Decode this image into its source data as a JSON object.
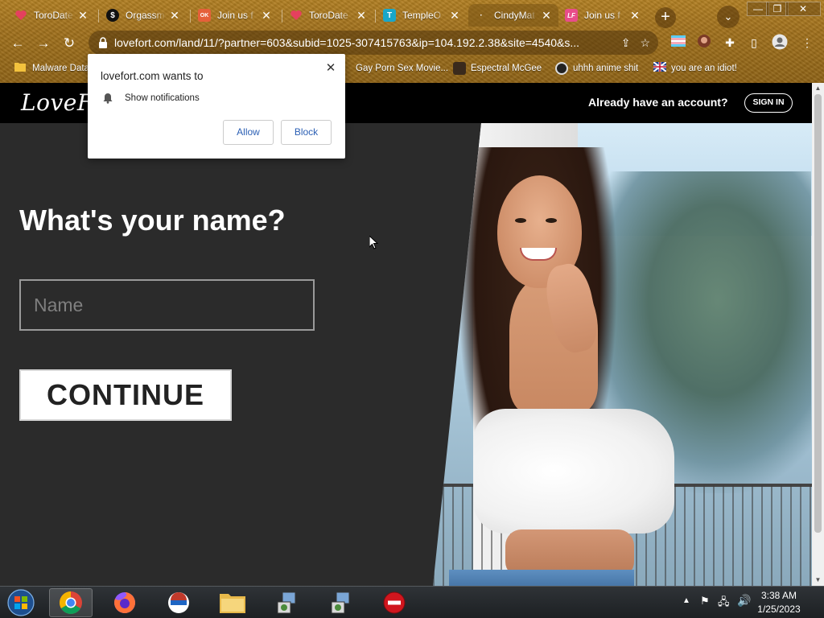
{
  "browser": {
    "tabs": [
      {
        "title": "ToroDate",
        "favicon": "heart-icon"
      },
      {
        "title": "Orgassmo",
        "favicon": "circle-s-icon"
      },
      {
        "title": "Join us f",
        "favicon": "ok-icon",
        "favicon_text": "OK"
      },
      {
        "title": "ToroDate",
        "favicon": "heart-icon"
      },
      {
        "title": "TempleO",
        "favicon": "temple-icon"
      },
      {
        "title": "CindyMat",
        "favicon": "dot-icon"
      },
      {
        "title": "Join us f",
        "favicon": "lf-icon",
        "favicon_text": "LF"
      }
    ],
    "url": "lovefort.com/land/11/?partner=603&subid=1025-307415763&ip=104.192.2.38&site=4540&s...",
    "bookmarks": [
      {
        "label": "Malware Data",
        "icon": "folder-icon"
      },
      {
        "label": "Gay Porn Sex Movie...",
        "icon": "film-icon"
      },
      {
        "label": "Espectral McGee",
        "icon": "ghost-icon"
      },
      {
        "label": "uhhh anime shit",
        "icon": "anime-icon"
      },
      {
        "label": "you are an idiot!",
        "icon": "flag-icon"
      }
    ]
  },
  "notification": {
    "title": "lovefort.com wants to",
    "permission": "Show notifications",
    "allow_label": "Allow",
    "block_label": "Block",
    "close_icon": "close-icon"
  },
  "site": {
    "logo": "LoveFort",
    "already_account": "Already have an account?",
    "signin_label": "SIGN IN",
    "question": "What's your name?",
    "name_placeholder": "Name",
    "name_value": "",
    "continue_label": "CONTINUE"
  },
  "taskbar": {
    "time": "3:38 AM",
    "date": "1/25/2023",
    "apps": [
      "start-orb-icon",
      "chrome-icon",
      "firefox-icon",
      "opera-icon",
      "folder-icon",
      "installer-icon",
      "installer-icon",
      "stop-icon"
    ]
  },
  "colors": {
    "theme": "#a0701b",
    "page_bg": "#2b2b2b",
    "header_bg": "#000000",
    "link_blue": "#2b5fb4"
  }
}
